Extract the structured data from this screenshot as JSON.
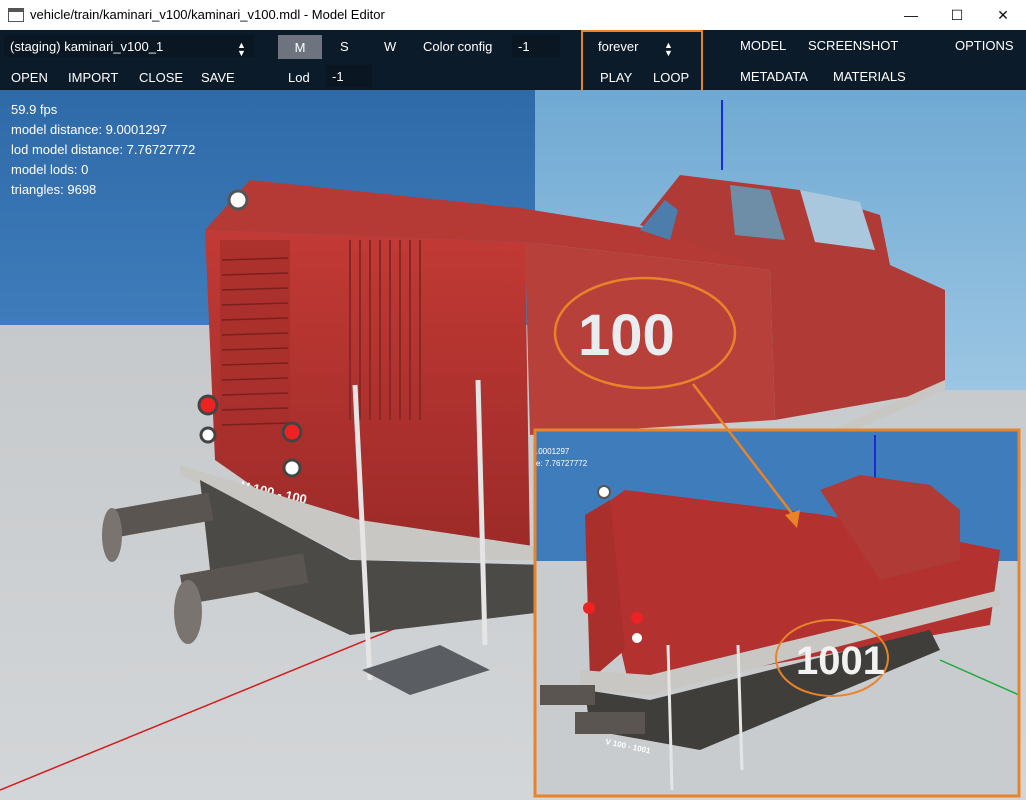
{
  "window": {
    "title": "vehicle/train/kaminari_v100/kaminari_v100.mdl - Model Editor",
    "controls": {
      "minimize": "—",
      "maximize": "☐",
      "close": "✕"
    }
  },
  "toolbar": {
    "model_select": "(staging) kaminari_v100_1",
    "mode_buttons": [
      "M",
      "S",
      "W"
    ],
    "active_mode": "M",
    "color_config_label": "Color config",
    "color_config_value": "-1",
    "lod_label": "Lod",
    "lod_value": "-1",
    "file_menu": [
      "OPEN",
      "IMPORT",
      "CLOSE",
      "SAVE"
    ],
    "anim_mode": "forever",
    "play": "PLAY",
    "loop": "LOOP",
    "right_menu": [
      "MODEL",
      "SCREENSHOT",
      "METADATA",
      "MATERIALS",
      "OPTIONS"
    ]
  },
  "stats": {
    "fps": "59.9 fps",
    "model_distance": "model distance: 9.0001297",
    "lod_distance": "lod model distance: 7.76727772",
    "model_lods": "model lods: 0",
    "triangles": "triangles: 9698"
  },
  "viewport": {
    "number_glitched": "100",
    "front_plate": "V 100 - 100",
    "inset_number": "1001",
    "inset_stat_1": ".0001297",
    "inset_stat_2": "e: 7.76727772",
    "inset_front_plate": "V 100 - 1001"
  },
  "colors": {
    "titlebar": "#ffffff",
    "toolbar": "#0c1b2a",
    "sky": "#3f7ab5",
    "floor": "#c9ccce",
    "train_red": "#b3312e",
    "highlight": "#e8832a"
  }
}
